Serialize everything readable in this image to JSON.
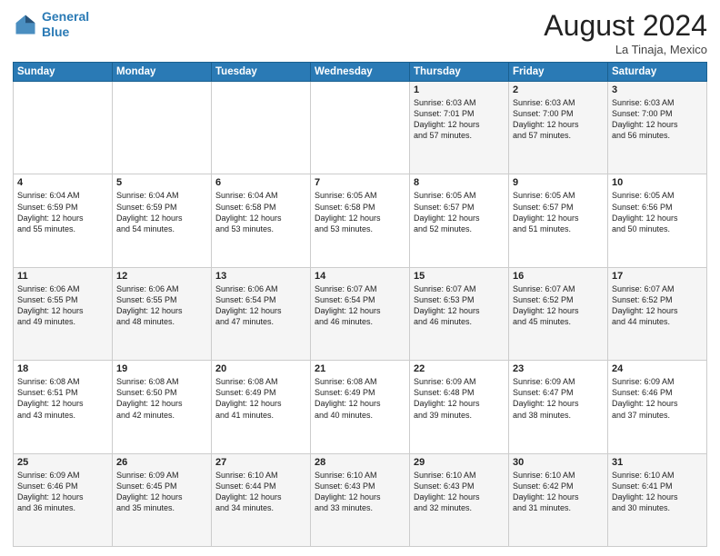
{
  "header": {
    "logo_line1": "General",
    "logo_line2": "Blue",
    "month_year": "August 2024",
    "location": "La Tinaja, Mexico"
  },
  "calendar": {
    "days_of_week": [
      "Sunday",
      "Monday",
      "Tuesday",
      "Wednesday",
      "Thursday",
      "Friday",
      "Saturday"
    ],
    "weeks": [
      [
        {
          "day": "",
          "info": ""
        },
        {
          "day": "",
          "info": ""
        },
        {
          "day": "",
          "info": ""
        },
        {
          "day": "",
          "info": ""
        },
        {
          "day": "1",
          "info": "Sunrise: 6:03 AM\nSunset: 7:01 PM\nDaylight: 12 hours\nand 57 minutes."
        },
        {
          "day": "2",
          "info": "Sunrise: 6:03 AM\nSunset: 7:00 PM\nDaylight: 12 hours\nand 57 minutes."
        },
        {
          "day": "3",
          "info": "Sunrise: 6:03 AM\nSunset: 7:00 PM\nDaylight: 12 hours\nand 56 minutes."
        }
      ],
      [
        {
          "day": "4",
          "info": "Sunrise: 6:04 AM\nSunset: 6:59 PM\nDaylight: 12 hours\nand 55 minutes."
        },
        {
          "day": "5",
          "info": "Sunrise: 6:04 AM\nSunset: 6:59 PM\nDaylight: 12 hours\nand 54 minutes."
        },
        {
          "day": "6",
          "info": "Sunrise: 6:04 AM\nSunset: 6:58 PM\nDaylight: 12 hours\nand 53 minutes."
        },
        {
          "day": "7",
          "info": "Sunrise: 6:05 AM\nSunset: 6:58 PM\nDaylight: 12 hours\nand 53 minutes."
        },
        {
          "day": "8",
          "info": "Sunrise: 6:05 AM\nSunset: 6:57 PM\nDaylight: 12 hours\nand 52 minutes."
        },
        {
          "day": "9",
          "info": "Sunrise: 6:05 AM\nSunset: 6:57 PM\nDaylight: 12 hours\nand 51 minutes."
        },
        {
          "day": "10",
          "info": "Sunrise: 6:05 AM\nSunset: 6:56 PM\nDaylight: 12 hours\nand 50 minutes."
        }
      ],
      [
        {
          "day": "11",
          "info": "Sunrise: 6:06 AM\nSunset: 6:55 PM\nDaylight: 12 hours\nand 49 minutes."
        },
        {
          "day": "12",
          "info": "Sunrise: 6:06 AM\nSunset: 6:55 PM\nDaylight: 12 hours\nand 48 minutes."
        },
        {
          "day": "13",
          "info": "Sunrise: 6:06 AM\nSunset: 6:54 PM\nDaylight: 12 hours\nand 47 minutes."
        },
        {
          "day": "14",
          "info": "Sunrise: 6:07 AM\nSunset: 6:54 PM\nDaylight: 12 hours\nand 46 minutes."
        },
        {
          "day": "15",
          "info": "Sunrise: 6:07 AM\nSunset: 6:53 PM\nDaylight: 12 hours\nand 46 minutes."
        },
        {
          "day": "16",
          "info": "Sunrise: 6:07 AM\nSunset: 6:52 PM\nDaylight: 12 hours\nand 45 minutes."
        },
        {
          "day": "17",
          "info": "Sunrise: 6:07 AM\nSunset: 6:52 PM\nDaylight: 12 hours\nand 44 minutes."
        }
      ],
      [
        {
          "day": "18",
          "info": "Sunrise: 6:08 AM\nSunset: 6:51 PM\nDaylight: 12 hours\nand 43 minutes."
        },
        {
          "day": "19",
          "info": "Sunrise: 6:08 AM\nSunset: 6:50 PM\nDaylight: 12 hours\nand 42 minutes."
        },
        {
          "day": "20",
          "info": "Sunrise: 6:08 AM\nSunset: 6:49 PM\nDaylight: 12 hours\nand 41 minutes."
        },
        {
          "day": "21",
          "info": "Sunrise: 6:08 AM\nSunset: 6:49 PM\nDaylight: 12 hours\nand 40 minutes."
        },
        {
          "day": "22",
          "info": "Sunrise: 6:09 AM\nSunset: 6:48 PM\nDaylight: 12 hours\nand 39 minutes."
        },
        {
          "day": "23",
          "info": "Sunrise: 6:09 AM\nSunset: 6:47 PM\nDaylight: 12 hours\nand 38 minutes."
        },
        {
          "day": "24",
          "info": "Sunrise: 6:09 AM\nSunset: 6:46 PM\nDaylight: 12 hours\nand 37 minutes."
        }
      ],
      [
        {
          "day": "25",
          "info": "Sunrise: 6:09 AM\nSunset: 6:46 PM\nDaylight: 12 hours\nand 36 minutes."
        },
        {
          "day": "26",
          "info": "Sunrise: 6:09 AM\nSunset: 6:45 PM\nDaylight: 12 hours\nand 35 minutes."
        },
        {
          "day": "27",
          "info": "Sunrise: 6:10 AM\nSunset: 6:44 PM\nDaylight: 12 hours\nand 34 minutes."
        },
        {
          "day": "28",
          "info": "Sunrise: 6:10 AM\nSunset: 6:43 PM\nDaylight: 12 hours\nand 33 minutes."
        },
        {
          "day": "29",
          "info": "Sunrise: 6:10 AM\nSunset: 6:43 PM\nDaylight: 12 hours\nand 32 minutes."
        },
        {
          "day": "30",
          "info": "Sunrise: 6:10 AM\nSunset: 6:42 PM\nDaylight: 12 hours\nand 31 minutes."
        },
        {
          "day": "31",
          "info": "Sunrise: 6:10 AM\nSunset: 6:41 PM\nDaylight: 12 hours\nand 30 minutes."
        }
      ]
    ]
  }
}
